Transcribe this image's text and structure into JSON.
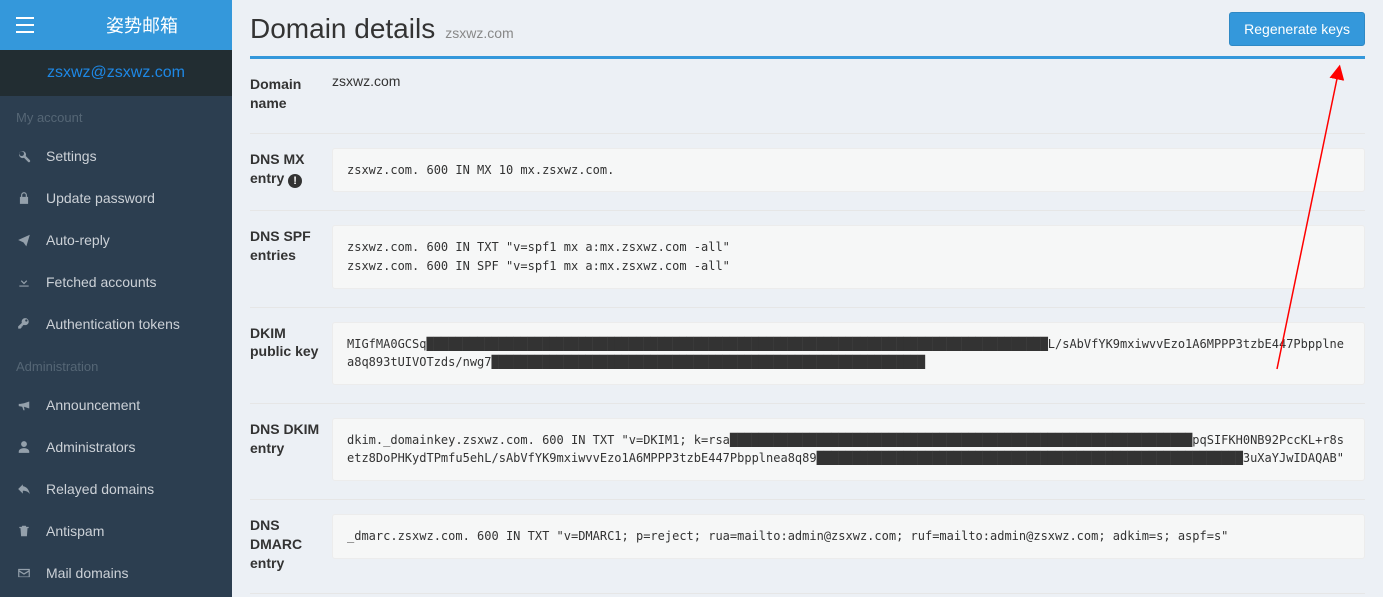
{
  "brand": "姿势邮箱",
  "user_email": "zsxwz@zsxwz.com",
  "nav": {
    "my_account_label": "My account",
    "settings": "Settings",
    "update_password": "Update password",
    "auto_reply": "Auto-reply",
    "fetched_accounts": "Fetched accounts",
    "auth_tokens": "Authentication tokens",
    "administration_label": "Administration",
    "announcement": "Announcement",
    "administrators": "Administrators",
    "relayed_domains": "Relayed domains",
    "antispam": "Antispam",
    "mail_domains": "Mail domains"
  },
  "page": {
    "title": "Domain details",
    "subtitle": "zsxwz.com",
    "regenerate_btn": "Regenerate keys"
  },
  "fields": {
    "labels": {
      "domain_name": "Domain name",
      "dns_mx": "DNS MX entry",
      "dns_spf": "DNS SPF entries",
      "dkim_pub": "DKIM public key",
      "dns_dkim": "DNS DKIM entry",
      "dns_dmarc": "DNS DMARC entry"
    },
    "domain_name_value": "zsxwz.com",
    "dns_mx_value": "zsxwz.com. 600 IN MX 10 mx.zsxwz.com.",
    "dns_spf_value": "zsxwz.com. 600 IN TXT \"v=spf1 mx a:mx.zsxwz.com -all\"\nzsxwz.com. 600 IN SPF \"v=spf1 mx a:mx.zsxwz.com -all\"",
    "dkim_pub_value": "MIGfMA0GCSq██████████████████████████████████████████████████████████████████████████████████████L/sAbVfYK9mxiwvvEzo1A6MPPP3tzbE447Pbpplnea8q893tUIVOTzds/nwg7████████████████████████████████████████████████████████████",
    "dns_dkim_value": "dkim._domainkey.zsxwz.com. 600 IN TXT \"v=DKIM1; k=rsa████████████████████████████████████████████████████████████████pqSIFKH0NB92PccKL+r8setz8DoPHKydTPmfu5ehL/sAbVfYK9mxiwvvEzo1A6MPPP3tzbE447Pbpplnea8q89███████████████████████████████████████████████████████████3uXaYJwIDAQAB\"",
    "dns_dmarc_value": "_dmarc.zsxwz.com. 600 IN TXT \"v=DMARC1; p=reject; rua=mailto:admin@zsxwz.com; ruf=mailto:admin@zsxwz.com; adkim=s; aspf=s\""
  }
}
